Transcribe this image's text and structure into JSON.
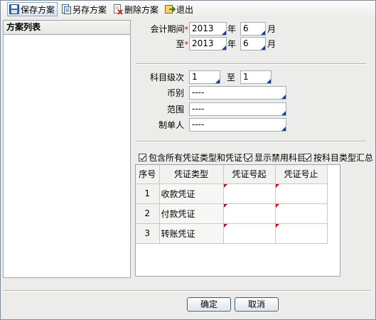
{
  "toolbar": {
    "save_label": "保存方案",
    "save_as_label": "另存方案",
    "delete_label": "删除方案",
    "exit_label": "退出"
  },
  "left_panel": {
    "title": "方案列表"
  },
  "period": {
    "from_label": "会计期间",
    "to_label": "至",
    "required_mark": "*",
    "from_year": "2013",
    "from_month": "6",
    "to_year": "2013",
    "to_month": "6",
    "year_unit": "年",
    "month_unit": "月"
  },
  "level": {
    "label": "科目级次",
    "from_value": "1",
    "to_label": "至",
    "to_value": "1"
  },
  "currency": {
    "label": "币别",
    "value": "----"
  },
  "scope": {
    "label": "范围",
    "value": "----"
  },
  "maker": {
    "label": "制单人",
    "value": "----"
  },
  "options": {
    "include_all": {
      "label": "包含所有凭证类型和凭证号",
      "checked": true
    },
    "show_disabled": {
      "label": "显示禁用科目",
      "checked": true
    },
    "group_by_type": {
      "label": "按科目类型汇总",
      "checked": true
    }
  },
  "grid": {
    "headers": [
      "序号",
      "凭证类型",
      "凭证号起",
      "凭证号止"
    ],
    "rows": [
      {
        "num": "1",
        "type": "收款凭证",
        "start": "",
        "end": ""
      },
      {
        "num": "2",
        "type": "付款凭证",
        "start": "",
        "end": ""
      },
      {
        "num": "3",
        "type": "转账凭证",
        "start": "",
        "end": ""
      }
    ]
  },
  "buttons": {
    "ok_label": "确定",
    "cancel_label": "取消"
  },
  "colors": {
    "accent": "#1a3f8f",
    "required": "#d00000",
    "window_bg": "#ececea"
  }
}
